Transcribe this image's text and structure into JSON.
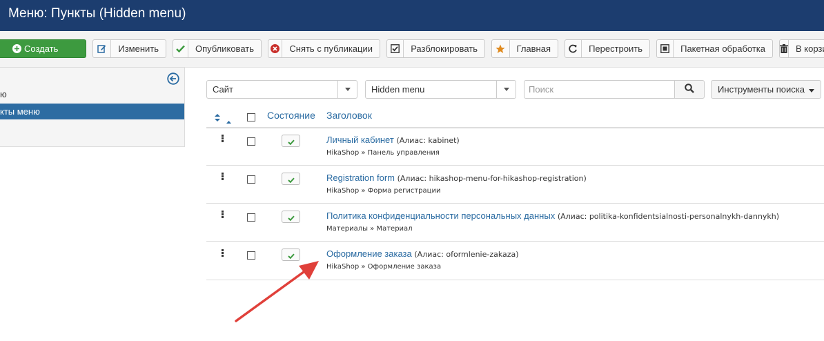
{
  "header": {
    "title": "Меню: Пункты (Hidden menu)"
  },
  "toolbar": {
    "create": "Создать",
    "edit": "Изменить",
    "publish": "Опубликовать",
    "unpublish": "Снять с публикации",
    "checkin": "Разблокировать",
    "home": "Главная",
    "rebuild": "Перестроить",
    "batch": "Пакетная обработка",
    "trash": "В корзину"
  },
  "sidebar": {
    "item_menus": "ю",
    "item_items": "кты меню"
  },
  "filters": {
    "client": "Сайт",
    "menu": "Hidden menu",
    "search_placeholder": "Поиск",
    "search_value": "",
    "tools": "Инструменты поиска"
  },
  "table": {
    "col_status": "Состояние",
    "col_title": "Заголовок",
    "rows": [
      {
        "title": "Личный кабинет",
        "alias": "(Алиас: kabinet)",
        "sub": "HikaShop » Панель управления"
      },
      {
        "title": "Registration form",
        "alias": "(Алиас: hikashop-menu-for-hikashop-registration)",
        "sub": "HikaShop » Форма регистрации"
      },
      {
        "title": "Политика конфиденциальности персональных данных",
        "alias": "(Алиас: politika-konfidentsialnosti-personalnykh-dannykh)",
        "sub": "Материалы » Материал"
      },
      {
        "title": "Оформление заказа",
        "alias": "(Алиас: oformlenie-zakaza)",
        "sub": "HikaShop » Оформление заказа"
      }
    ]
  },
  "colors": {
    "header_bg": "#1c3d6f",
    "create_green": "#3d9a3f",
    "link_blue": "#2a6ba2",
    "active_blue": "#2d6ca2",
    "arrow_red": "#e0403a"
  }
}
